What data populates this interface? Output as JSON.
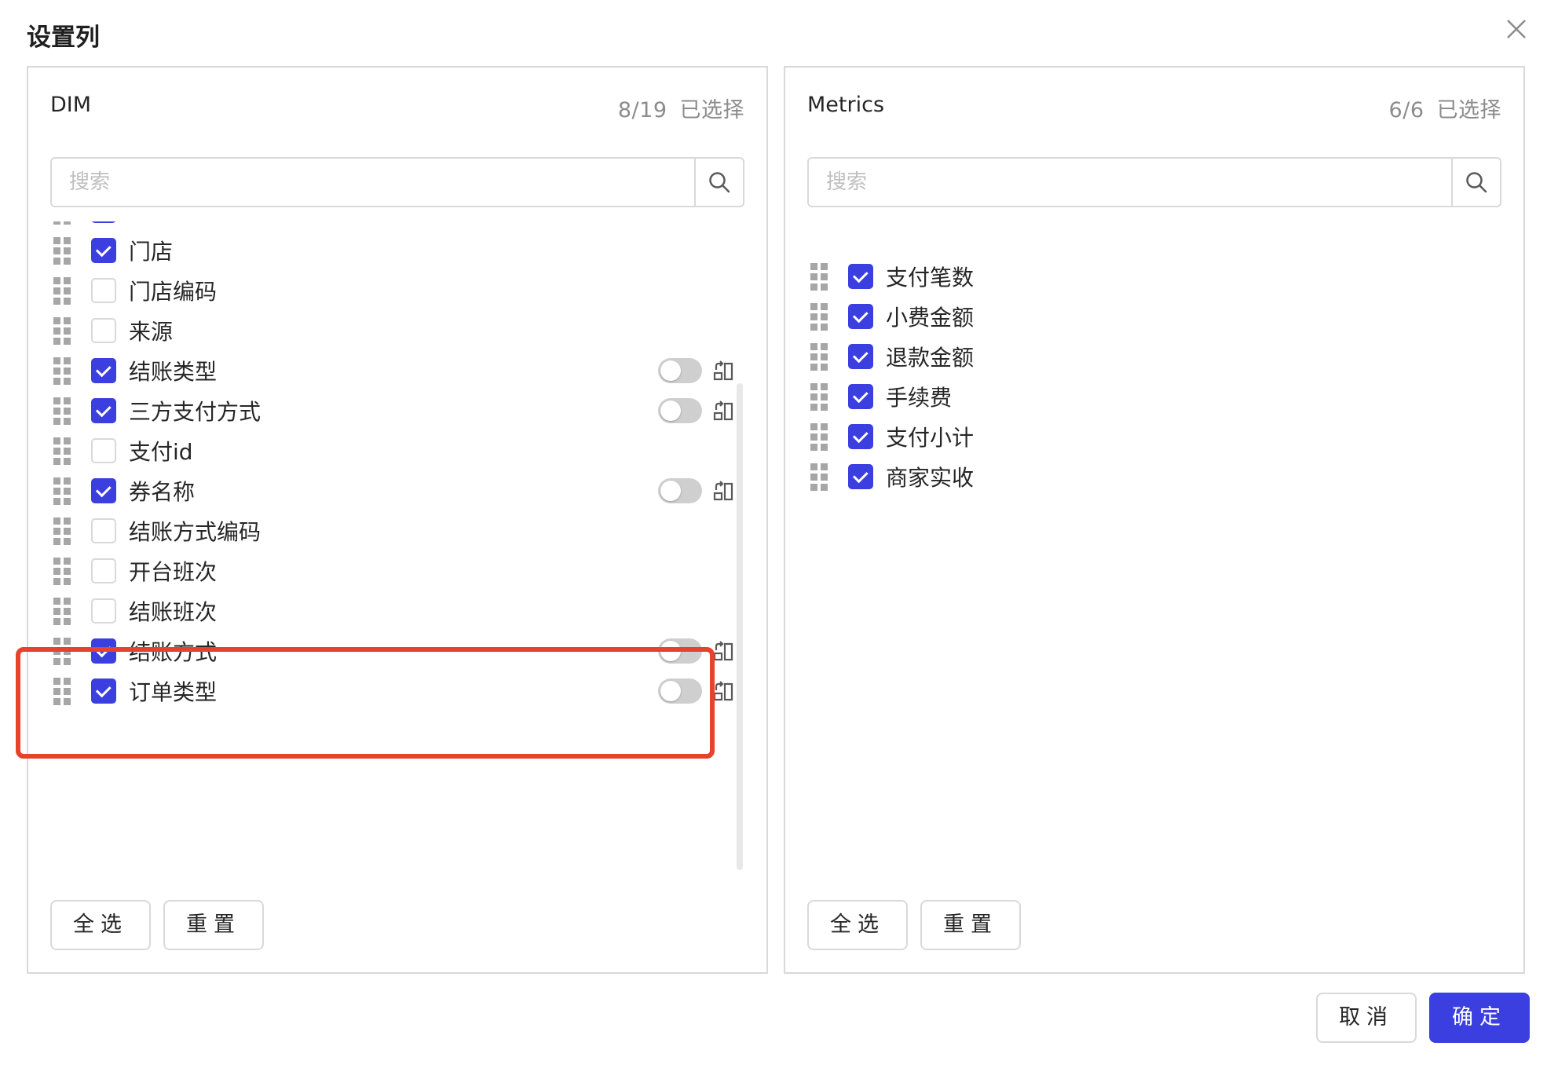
{
  "dialog": {
    "title": "设置列"
  },
  "left_panel": {
    "name": "DIM",
    "count": "8/19",
    "selected_text": "已选择",
    "search_placeholder": "搜索",
    "items": [
      {
        "label": "",
        "checked": true,
        "partial": true,
        "toggle": false
      },
      {
        "label": "门店",
        "checked": true,
        "toggle": false
      },
      {
        "label": "门店编码",
        "checked": false,
        "toggle": false
      },
      {
        "label": "来源",
        "checked": false,
        "toggle": false
      },
      {
        "label": "结账类型",
        "checked": true,
        "toggle": true
      },
      {
        "label": "三方支付方式",
        "checked": true,
        "toggle": true
      },
      {
        "label": "支付id",
        "checked": false,
        "toggle": false
      },
      {
        "label": "券名称",
        "checked": true,
        "toggle": true
      },
      {
        "label": "结账方式编码",
        "checked": false,
        "toggle": false
      },
      {
        "label": "开台班次",
        "checked": false,
        "toggle": false
      },
      {
        "label": "结账班次",
        "checked": false,
        "toggle": false
      },
      {
        "label": "结账方式",
        "checked": true,
        "toggle": true
      },
      {
        "label": "订单类型",
        "checked": true,
        "toggle": true
      }
    ],
    "select_all_label": "全选",
    "reset_label": "重置"
  },
  "right_panel": {
    "name": "Metrics",
    "count": "6/6",
    "selected_text": "已选择",
    "search_placeholder": "搜索",
    "items": [
      {
        "label": "支付笔数",
        "checked": true
      },
      {
        "label": "小费金额",
        "checked": true
      },
      {
        "label": "退款金额",
        "checked": true
      },
      {
        "label": "手续费",
        "checked": true
      },
      {
        "label": "支付小计",
        "checked": true
      },
      {
        "label": "商家实收",
        "checked": true
      }
    ],
    "select_all_label": "全选",
    "reset_label": "重置"
  },
  "footer": {
    "cancel_label": "取消",
    "ok_label": "确定"
  },
  "colors": {
    "accent": "#3b3fe0",
    "highlight": "#e8412c",
    "border": "#d9d9d9"
  },
  "icons": {
    "close": "close-icon",
    "search": "search-icon",
    "drag": "drag-handle-icon",
    "pin": "pin-column-icon"
  }
}
